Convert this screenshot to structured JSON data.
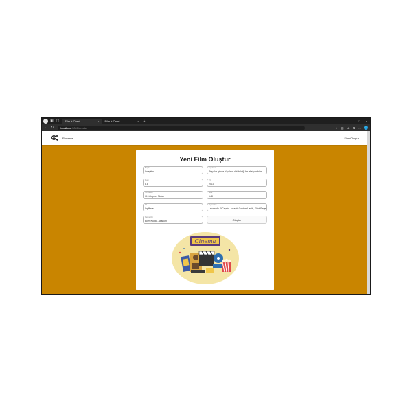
{
  "browser": {
    "tabs": [
      {
        "label": "Film + Oneri",
        "active": true
      },
      {
        "label": "Film + Oneri",
        "active": false
      }
    ],
    "url_host": "localhost",
    "url_path": ":3000/create"
  },
  "app": {
    "brand": "Filmania",
    "nav_create": "Film Oluştur",
    "accent_color": "#c98500"
  },
  "form": {
    "title": "Yeni Film Oluştur",
    "fields": [
      {
        "label": "Başlık",
        "value": "Inception"
      },
      {
        "label": "Açıklama",
        "value": "Rüyalar içinde rüyalara dalabildiği bir aksiyon bilim..."
      },
      {
        "label": "Puan",
        "value": "8.8"
      },
      {
        "label": "Yıl",
        "value": "2010"
      },
      {
        "label": "Yönetmen",
        "value": "Christopher Nolan"
      },
      {
        "label": "Süre",
        "value": "148"
      },
      {
        "label": "Dil",
        "value": "İngilizce"
      },
      {
        "label": "Oyuncular",
        "value": "Leonardo DiCaprio, Joseph Gordon-Levitt, Elliot Page"
      },
      {
        "label": "Kategoriler",
        "value": "Bilim Kurgu, Aksiyon"
      }
    ],
    "submit_label": "Oluştur"
  },
  "illustration": {
    "sign_text": "Cinema"
  }
}
